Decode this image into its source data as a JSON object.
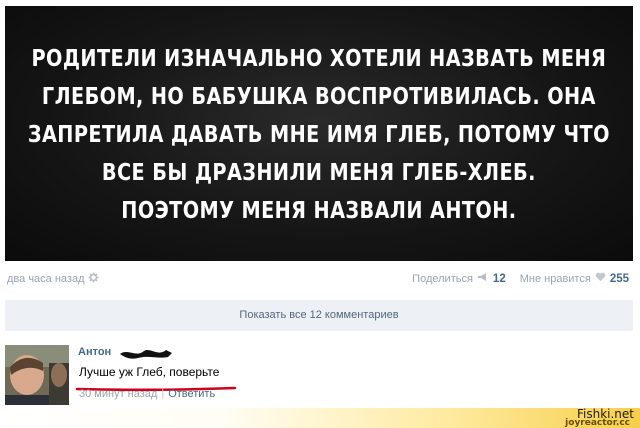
{
  "post": {
    "image_lines": [
      "Родители изначально хотели назвать меня",
      "Глебом, но бабушка воспротивилась. Она",
      "запретила давать мне имя Глеб, потому что",
      "все бы дразнили меня Глеб-хлеб.",
      "Поэтому меня назвали Антон."
    ],
    "time": "два часа назад",
    "share_label": "Поделиться",
    "share_count": "12",
    "like_label": "Мне нравится",
    "like_count": "255",
    "show_comments_label": "Показать все 12 комментариев"
  },
  "comment": {
    "author": "Антон",
    "text": "Лучше уж Глеб, поверьте",
    "time": "30 минут назад",
    "separator": "|",
    "reply_label": "Ответить"
  },
  "watermarks": {
    "site": "Fishki.net",
    "source": "joyreactor.cc"
  },
  "colors": {
    "link": "#45688e",
    "muted": "#9aa3ad",
    "underline": "#d0021b",
    "footer_gold": "#f6cf4a"
  },
  "icons": {
    "gear": "gear-icon",
    "share": "megaphone-icon",
    "like": "heart-icon"
  }
}
